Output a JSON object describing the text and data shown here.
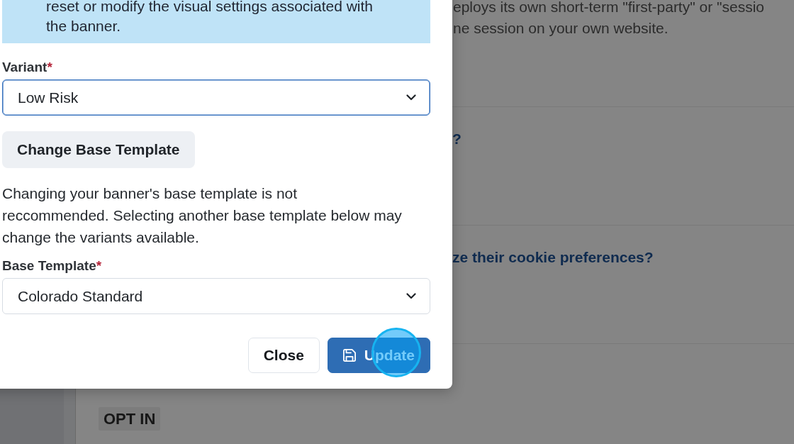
{
  "page_behind": {
    "sections": [
      {
        "kind": "paragraph",
        "lines": [
          "eploys its own short-term \"first-party\" or \"sessio",
          "ne session on your own website."
        ]
      },
      {
        "kind": "heading",
        "text": "?"
      },
      {
        "kind": "heading",
        "text": "ze their cookie preferences?"
      },
      {
        "kind": "badge",
        "text": "OPT IN"
      }
    ]
  },
  "dialog": {
    "notice": {
      "lines": [
        "reset or modify the visual settings associated with",
        "the banner."
      ]
    },
    "body": [
      {
        "kind": "select",
        "label": "Variant",
        "required_mark": "*",
        "value": "Low Risk",
        "focused": true
      },
      {
        "kind": "button",
        "label": "Change Base Template"
      },
      {
        "kind": "text",
        "lines": [
          "Changing your banner's base template is not",
          "reccommended. Selecting another base template below may",
          "change the variants available."
        ]
      },
      {
        "kind": "select",
        "label": "Base Template",
        "required_mark": "*",
        "value": "Colorado Standard",
        "focused": false
      }
    ],
    "footer_buttons": [
      {
        "label": "Close",
        "kind": "secondary",
        "clicked": false
      },
      {
        "label": "Update",
        "kind": "save",
        "clicked": true
      }
    ]
  }
}
